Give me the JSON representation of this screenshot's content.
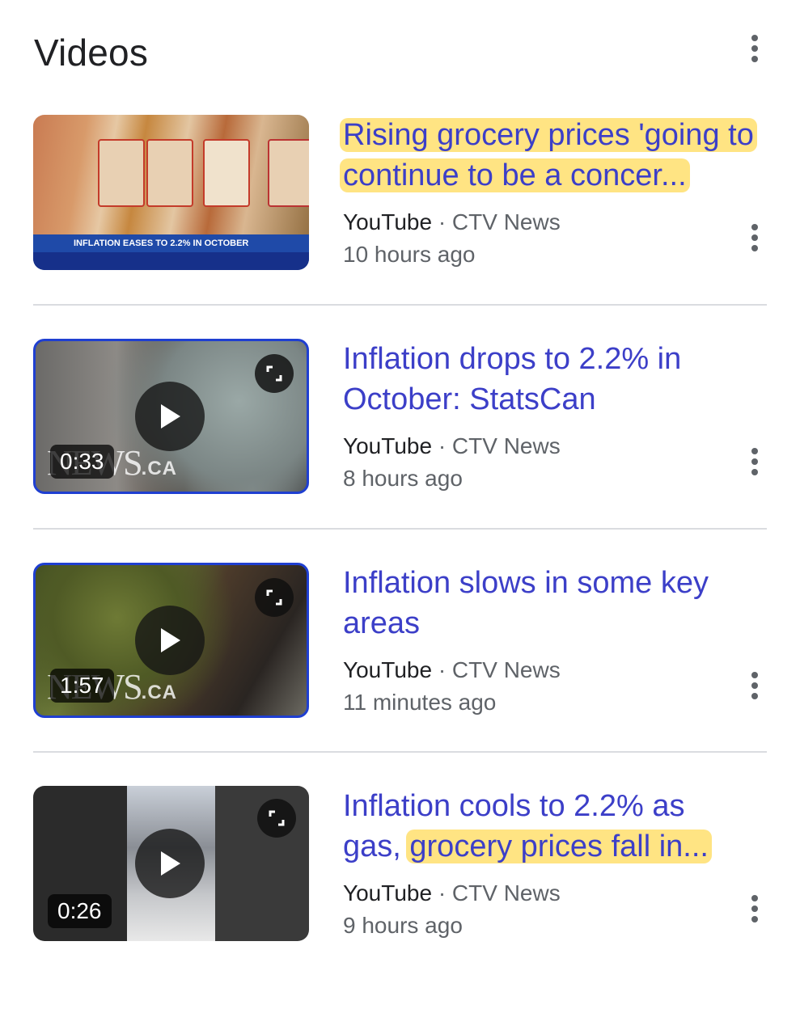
{
  "section": {
    "title": "Videos",
    "more_icon": "more-vert-icon"
  },
  "results": [
    {
      "title_highlighted": "Rising grocery prices 'going to continue to be a concer...",
      "title_plain": "",
      "highlight_color": "#ffd540",
      "source": "YouTube",
      "separator": "·",
      "channel": "CTV News",
      "time": "10 hours ago",
      "duration": "",
      "thumbnail_text": "INFLATION EASES TO 2.2% IN OCTOBER",
      "outlined": false
    },
    {
      "title_plain": "Inflation drops to 2.2% in October: StatsCan",
      "source": "YouTube",
      "separator": "·",
      "channel": "CTV News",
      "time": "8 hours ago",
      "duration": "0:33",
      "watermark": "NEWS",
      "watermark_suffix": ".CA",
      "outlined": true
    },
    {
      "title_plain": "Inflation slows in some key areas",
      "source": "YouTube",
      "separator": "·",
      "channel": "CTV News",
      "time": "11 minutes ago",
      "duration": "1:57",
      "watermark": "NEWS",
      "watermark_suffix": ".CA",
      "outlined": true
    },
    {
      "title_plain": "Inflation cools to 2.2% as",
      "title_plain_2": "gas, ",
      "title_highlighted": "grocery prices fall in...",
      "source": "YouTube",
      "separator": "·",
      "channel": "CTV News",
      "time": "9 hours ago",
      "duration": "0:26",
      "outlined": false
    }
  ],
  "colors": {
    "link": "#3c3fc8",
    "meta": "#5f6368",
    "outline": "#1f3fd1"
  }
}
